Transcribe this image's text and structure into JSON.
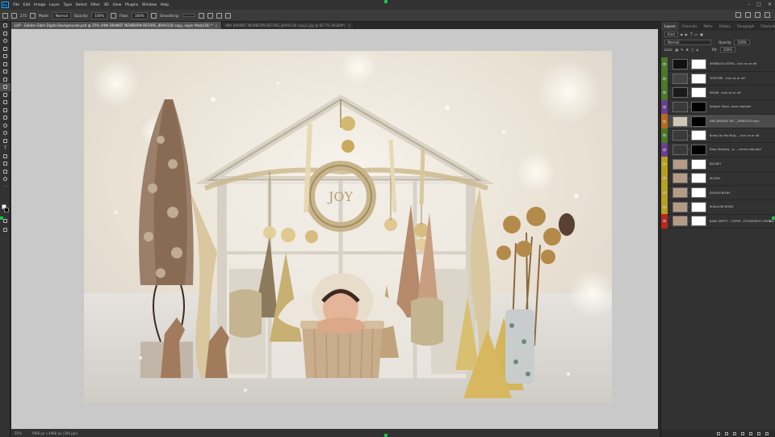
{
  "menu": [
    "File",
    "Edit",
    "Image",
    "Layer",
    "Type",
    "Select",
    "Filter",
    "3D",
    "View",
    "Plugins",
    "Window",
    "Help"
  ],
  "app_logo": "Ps",
  "options": {
    "mode_label": "Mode:",
    "mode_value": "Normal",
    "opacity_label": "Opacity:",
    "opacity_value": "100%",
    "flow_label": "Flow:",
    "flow_value": "100%",
    "smoothing_label": "Smoothing:",
    "brush_size": "275"
  },
  "tabs": [
    {
      "label": "LUP - Golden Glam Digital Backgrounds.psd @ 25% (ANA BRANDT NEWBORN BEFORE_BRAH128 copy, Layer Mask/16) *"
    },
    {
      "label": "ANA BRANDT NEWBORN BEFORE_BRAH128 copy1.jpg @ 66.7% (RGB/8*)"
    }
  ],
  "status": {
    "zoom": "25%",
    "doc_info": "7968 px x 4968 px (300 ppi)"
  },
  "panel": {
    "tabs": [
      "Layers",
      "Channels",
      "Paths",
      "History",
      "Paragraph",
      "Character"
    ],
    "kind_label": "Kind",
    "blend_mode": "Normal",
    "opacity_label": "Opacity:",
    "opacity_value": "100%",
    "lock_label": "Lock:",
    "fill_label": "Fill:",
    "fill_value": "100%"
  },
  "layers": [
    {
      "name": "SPARKLES EXTRA - turn on or off",
      "color": "#4a7a2a",
      "thumb": "#111"
    },
    {
      "name": "TEXTURE - turn on or off",
      "color": "#4a7a2a",
      "thumb": "#444"
    },
    {
      "name": "SNOW - turn on or off",
      "color": "#4a7a2a",
      "thumb": "#1a1a1a"
    },
    {
      "name": "Subject Shad...here required",
      "color": "#6a3f91",
      "thumb": "#3a3a3a"
    },
    {
      "name": "ANA BRANDT NE..._BRAH128 copy",
      "color": "#b86a1c",
      "thumb": "#cfc6b8"
    },
    {
      "name": "Bump Up the Brig...- turn on or off",
      "color": "#4a7a2a",
      "thumb": "#3a3a3a"
    },
    {
      "name": "Drop Shading - p......ohere required",
      "color": "#6a3f91",
      "thumb": "#3a3a3a"
    },
    {
      "name": "BUCKET",
      "color": "#b8a01c",
      "thumb": "#b49c84"
    },
    {
      "name": "SLEIGH",
      "color": "#b8a01c",
      "thumb": "#b49c84"
    },
    {
      "name": "DOUGH BOWL",
      "color": "#b8a01c",
      "thumb": "#b49c84"
    },
    {
      "name": "SHALLOW BOWL",
      "color": "#b8a01c",
      "thumb": "#b49c84"
    },
    {
      "name": "BASE EMPTY - COPYR...OTOGRAPHY LIMITED",
      "color": "#b8281c",
      "thumb": "#b49c84"
    }
  ],
  "photo": {
    "wreath_text": "JOY"
  }
}
